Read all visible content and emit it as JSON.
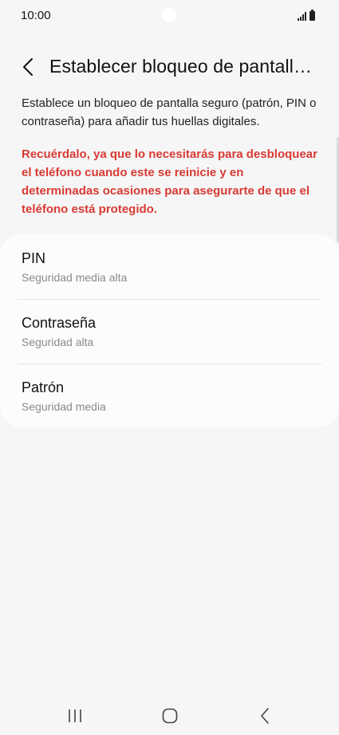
{
  "status_bar": {
    "time": "10:00"
  },
  "header": {
    "title": "Establecer bloqueo de pantall…"
  },
  "description": "Establece un bloqueo de pantalla seguro (patrón, PIN o contraseña) para añadir tus huellas digitales.",
  "warning": "Recuérdalo, ya que lo necesitarás para desbloquear el teléfono cuando este se reinicie y en determinadas ocasiones para asegurarte de que el teléfono está protegido.",
  "options": [
    {
      "title": "PIN",
      "subtitle": "Seguridad media alta"
    },
    {
      "title": "Contraseña",
      "subtitle": "Seguridad alta"
    },
    {
      "title": "Patrón",
      "subtitle": "Seguridad media"
    }
  ],
  "colors": {
    "background": "#f6f6f6",
    "card": "#fcfcfc",
    "warning": "#d83a34",
    "subtitle": "#8a8a8a"
  },
  "icons": {
    "back": "chevron-left-icon",
    "nav_recents": "recents-icon",
    "nav_home": "home-icon",
    "nav_back": "back-icon",
    "signal": "signal-icon",
    "battery": "battery-icon"
  }
}
